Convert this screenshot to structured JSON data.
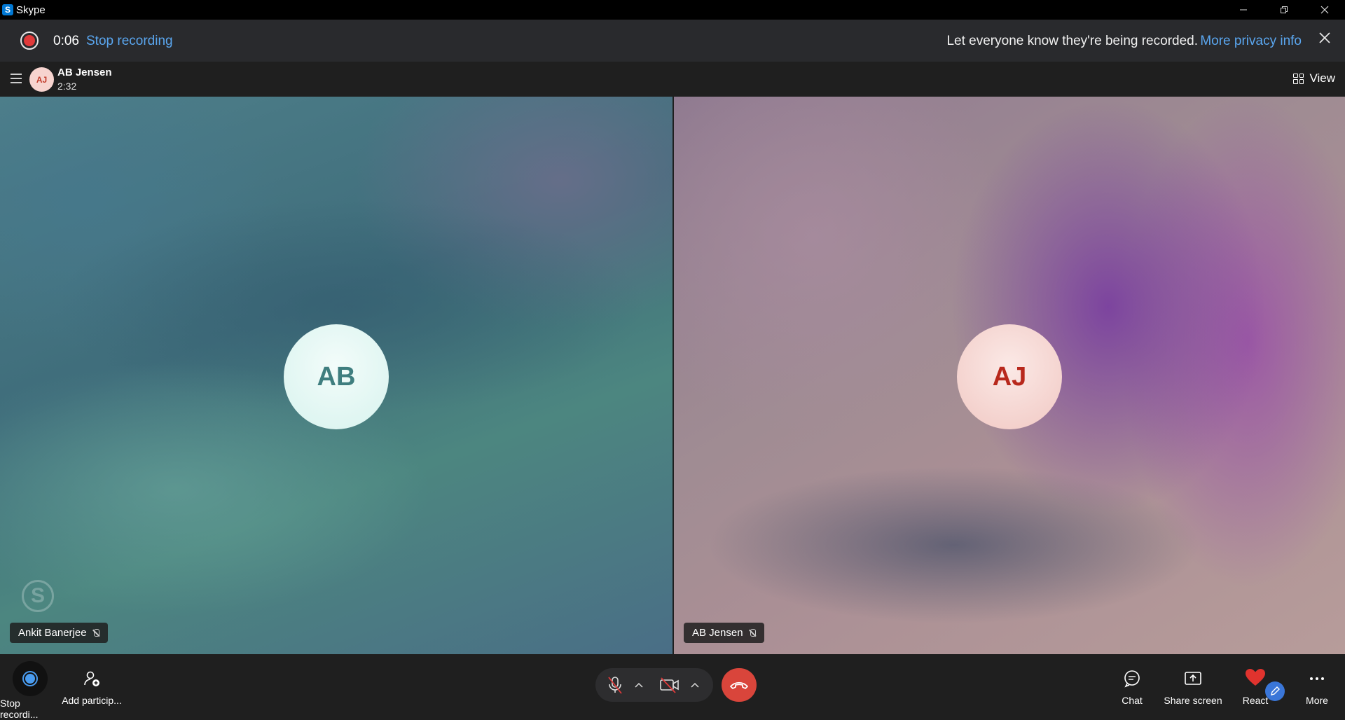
{
  "window": {
    "title": "Skype",
    "logo_letter": "S"
  },
  "recording": {
    "elapsed": "0:06",
    "stop_label": "Stop recording",
    "notice": "Let everyone know they're being recorded.",
    "privacy_link": "More privacy info"
  },
  "header": {
    "avatar_initials": "AJ",
    "contact_name": "AB Jensen",
    "call_duration": "2:32",
    "view_label": "View"
  },
  "participants": [
    {
      "initials": "AB",
      "name": "Ankit Banerjee",
      "muted": true
    },
    {
      "initials": "AJ",
      "name": "AB Jensen",
      "muted": true
    }
  ],
  "controls": {
    "stop_recording_label": "Stop recordi...",
    "add_participants_label": "Add particip...",
    "chat_label": "Chat",
    "share_screen_label": "Share screen",
    "react_label": "React",
    "more_label": "More"
  },
  "colors": {
    "accent": "#5aa6ef",
    "record": "#e03a3a",
    "hangup": "#d9453b",
    "react_heart": "#e0332e"
  }
}
